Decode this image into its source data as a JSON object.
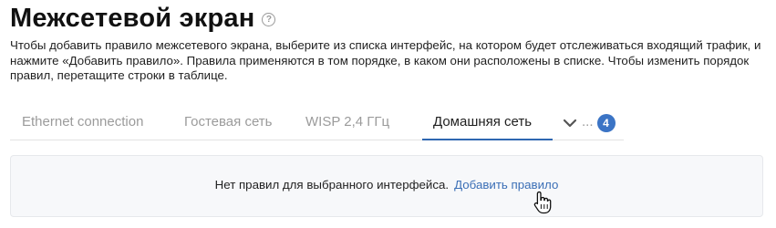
{
  "page": {
    "title": "Межсетевой экран",
    "help_icon": "question-circle-icon",
    "description": "Чтобы добавить правило межсетевого экрана, выберите из списка интерфейс, на котором будет отслеживаться входящий трафик, и нажмите «Добавить правило». Правила применяются в том порядке, в каком они расположены в списке. Чтобы изменить порядок правил, перетащите строки в таблице."
  },
  "tabs": {
    "items": [
      {
        "label": "Ethernet connection",
        "active": false
      },
      {
        "label": "Гостевая сеть",
        "active": false
      },
      {
        "label": "WISP 2,4 ГГц",
        "active": false
      },
      {
        "label": "Домашняя сеть",
        "active": true
      }
    ],
    "more_icon": "chevron-down-icon",
    "more_ellipsis": "...",
    "more_count": "4",
    "accent_color": "#2f67b1"
  },
  "empty_state": {
    "message": "Нет правил для выбранного интерфейса.",
    "action_label": "Добавить правило",
    "link_color": "#3b6fb6"
  },
  "cursor": {
    "icon": "hand-pointer-icon"
  }
}
